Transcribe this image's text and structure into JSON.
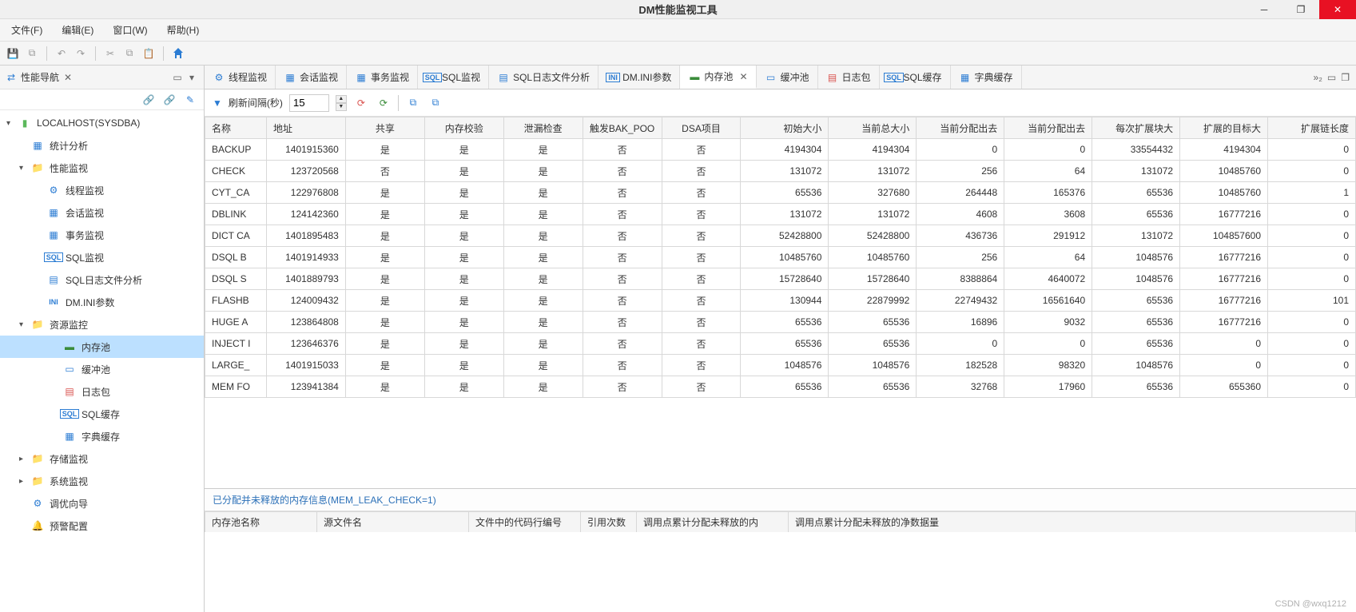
{
  "window": {
    "title": "DM性能监视工具"
  },
  "menu": {
    "file": "文件(F)",
    "edit": "编辑(E)",
    "window": "窗口(W)",
    "help": "帮助(H)"
  },
  "sidebar": {
    "title": "性能导航",
    "host": "LOCALHOST(SYSDBA)",
    "items": {
      "stat": "统计分析",
      "perf": "性能监视",
      "perf_children": [
        "线程监视",
        "会话监视",
        "事务监视",
        "SQL监视",
        "SQL日志文件分析",
        "DM.INI参数"
      ],
      "res": "资源监控",
      "res_children": [
        "内存池",
        "缓冲池",
        "日志包",
        "SQL缓存",
        "字典缓存"
      ],
      "store": "存储监视",
      "sys": "系统监视",
      "tuning": "调优向导",
      "alert": "预警配置"
    }
  },
  "tabs": {
    "list": [
      "线程监视",
      "会话监视",
      "事务监视",
      "SQL监视",
      "SQL日志文件分析",
      "DM.INI参数",
      "内存池",
      "缓冲池",
      "日志包",
      "SQL缓存",
      "字典缓存"
    ],
    "active": "内存池",
    "more": "»₂"
  },
  "tabToolbar": {
    "refreshLabel": "刷新间隔(秒)",
    "interval": "15"
  },
  "table": {
    "columns": [
      "名称",
      "地址",
      "共享",
      "内存校验",
      "泄漏检查",
      "触发BAK_POO",
      "DSA项目",
      "初始大小",
      "当前总大小",
      "当前分配出去",
      "当前分配出去",
      "每次扩展块大",
      "扩展的目标大",
      "扩展链长度"
    ],
    "rows": [
      {
        "name": "BACKUP",
        "addr": "1401915360",
        "share": "是",
        "check": "是",
        "leak": "是",
        "bak": "否",
        "dsa": "否",
        "init": 4194304,
        "total": 4194304,
        "alloc1": 0,
        "alloc2": 0,
        "ext": 33554432,
        "target": 4194304,
        "chain": 0
      },
      {
        "name": "CHECK",
        "addr": "123720568",
        "share": "否",
        "check": "是",
        "leak": "是",
        "bak": "否",
        "dsa": "否",
        "init": 131072,
        "total": 131072,
        "alloc1": 256,
        "alloc2": 64,
        "ext": 131072,
        "target": 10485760,
        "chain": 0
      },
      {
        "name": "CYT_CA",
        "addr": "122976808",
        "share": "是",
        "check": "是",
        "leak": "是",
        "bak": "否",
        "dsa": "否",
        "init": 65536,
        "total": 327680,
        "alloc1": 264448,
        "alloc2": 165376,
        "ext": 65536,
        "target": 10485760,
        "chain": 1
      },
      {
        "name": "DBLINK",
        "addr": "124142360",
        "share": "是",
        "check": "是",
        "leak": "是",
        "bak": "否",
        "dsa": "否",
        "init": 131072,
        "total": 131072,
        "alloc1": 4608,
        "alloc2": 3608,
        "ext": 65536,
        "target": 16777216,
        "chain": 0
      },
      {
        "name": "DICT CA",
        "addr": "1401895483",
        "share": "是",
        "check": "是",
        "leak": "是",
        "bak": "否",
        "dsa": "否",
        "init": 52428800,
        "total": 52428800,
        "alloc1": 436736,
        "alloc2": 291912,
        "ext": 131072,
        "target": 104857600,
        "chain": 0
      },
      {
        "name": "DSQL B",
        "addr": "1401914933",
        "share": "是",
        "check": "是",
        "leak": "是",
        "bak": "否",
        "dsa": "否",
        "init": 10485760,
        "total": 10485760,
        "alloc1": 256,
        "alloc2": 64,
        "ext": 1048576,
        "target": 16777216,
        "chain": 0
      },
      {
        "name": "DSQL S",
        "addr": "1401889793",
        "share": "是",
        "check": "是",
        "leak": "是",
        "bak": "否",
        "dsa": "否",
        "init": 15728640,
        "total": 15728640,
        "alloc1": 8388864,
        "alloc2": 4640072,
        "ext": 1048576,
        "target": 16777216,
        "chain": 0
      },
      {
        "name": "FLASHB",
        "addr": "124009432",
        "share": "是",
        "check": "是",
        "leak": "是",
        "bak": "否",
        "dsa": "否",
        "init": 130944,
        "total": 22879992,
        "alloc1": 22749432,
        "alloc2": 16561640,
        "ext": 65536,
        "target": 16777216,
        "chain": 101
      },
      {
        "name": "HUGE A",
        "addr": "123864808",
        "share": "是",
        "check": "是",
        "leak": "是",
        "bak": "否",
        "dsa": "否",
        "init": 65536,
        "total": 65536,
        "alloc1": 16896,
        "alloc2": 9032,
        "ext": 65536,
        "target": 16777216,
        "chain": 0
      },
      {
        "name": "INJECT I",
        "addr": "123646376",
        "share": "是",
        "check": "是",
        "leak": "是",
        "bak": "否",
        "dsa": "否",
        "init": 65536,
        "total": 65536,
        "alloc1": 0,
        "alloc2": 0,
        "ext": 65536,
        "target": 0,
        "chain": 0
      },
      {
        "name": "LARGE_",
        "addr": "1401915033",
        "share": "是",
        "check": "是",
        "leak": "是",
        "bak": "否",
        "dsa": "否",
        "init": 1048576,
        "total": 1048576,
        "alloc1": 182528,
        "alloc2": 98320,
        "ext": 1048576,
        "target": 0,
        "chain": 0
      },
      {
        "name": "MEM FO",
        "addr": "123941384",
        "share": "是",
        "check": "是",
        "leak": "是",
        "bak": "否",
        "dsa": "否",
        "init": 65536,
        "total": 65536,
        "alloc1": 32768,
        "alloc2": 17960,
        "ext": 65536,
        "target": 655360,
        "chain": 0
      }
    ]
  },
  "subPanel": {
    "title": "已分配并未释放的内存信息(MEM_LEAK_CHECK=1)",
    "columns": [
      "内存池名称",
      "源文件名",
      "文件中的代码行编号",
      "引用次数",
      "调用点累计分配未释放的内",
      "调用点累计分配未释放的净数据量"
    ]
  },
  "watermark": "CSDN @wxq1212"
}
